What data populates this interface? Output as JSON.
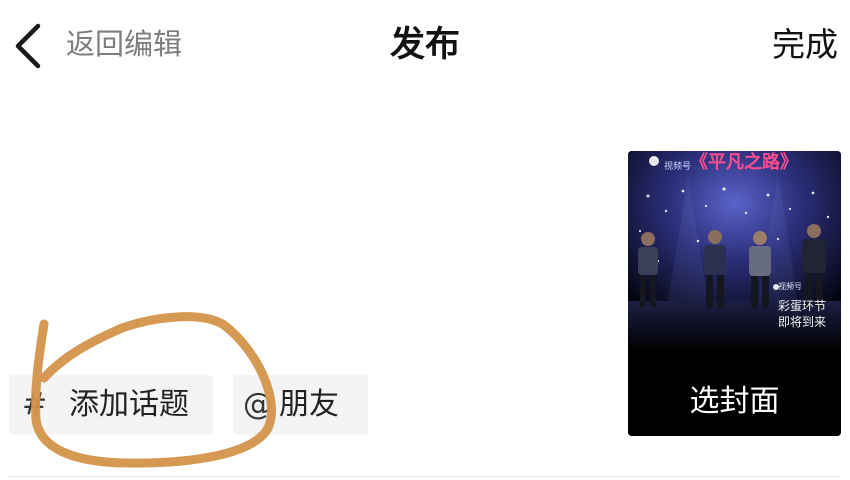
{
  "header": {
    "back_label": "返回编辑",
    "title": "发布",
    "done_label": "完成"
  },
  "tags": {
    "topic_symbol": "#",
    "topic_label": "添加话题",
    "friend_symbol": "@",
    "friend_label": "朋友"
  },
  "cover": {
    "select_label": "选封面",
    "video_title": "《平凡之路》",
    "logo_text": "视频号",
    "caption_line1": "彩蛋环节",
    "caption_line2": "即将到来"
  },
  "colors": {
    "annotation_stroke": "#d3934a",
    "chip_bg": "#f4f4f4",
    "cover_title": "#ff4d8d"
  },
  "icons": {
    "back": "chevron-left-icon",
    "annotation": "hand-drawn-circle"
  }
}
